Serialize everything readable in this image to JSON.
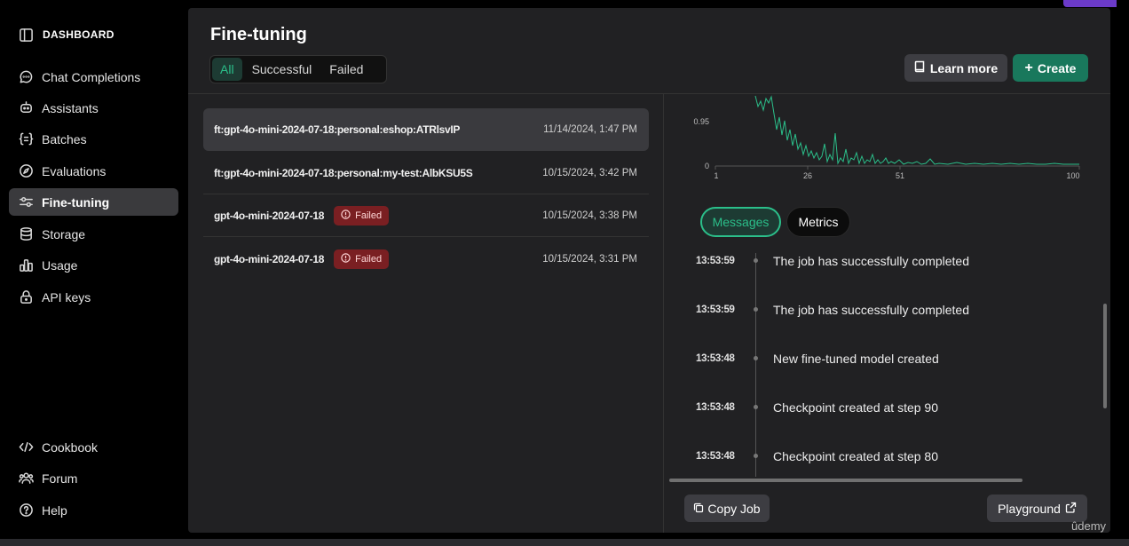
{
  "sidebar": {
    "brand": "DASHBOARD",
    "items": [
      {
        "label": "Chat Completions",
        "icon": "chat-icon"
      },
      {
        "label": "Assistants",
        "icon": "robot-icon"
      },
      {
        "label": "Batches",
        "icon": "braces-icon"
      },
      {
        "label": "Evaluations",
        "icon": "compass-icon"
      },
      {
        "label": "Fine-tuning",
        "icon": "sliders-icon"
      },
      {
        "label": "Storage",
        "icon": "database-icon"
      },
      {
        "label": "Usage",
        "icon": "chart-icon"
      },
      {
        "label": "API keys",
        "icon": "lock-icon"
      }
    ],
    "bottom_items": [
      {
        "label": "Cookbook",
        "icon": "code-icon"
      },
      {
        "label": "Forum",
        "icon": "users-icon"
      },
      {
        "label": "Help",
        "icon": "help-icon"
      }
    ]
  },
  "header": {
    "title": "Fine-tuning",
    "tabs": [
      "All",
      "Successful",
      "Failed"
    ],
    "learn_more": "Learn more",
    "create": "Create"
  },
  "jobs": [
    {
      "name": "ft:gpt-4o-mini-2024-07-18:personal:eshop:ATRlsvIP",
      "date": "11/14/2024, 1:47 PM",
      "status": ""
    },
    {
      "name": "ft:gpt-4o-mini-2024-07-18:personal:my-test:AlbKSU5S",
      "date": "10/15/2024, 3:42 PM",
      "status": ""
    },
    {
      "name": "gpt-4o-mini-2024-07-18",
      "date": "10/15/2024, 3:38 PM",
      "status": "Failed"
    },
    {
      "name": "gpt-4o-mini-2024-07-18",
      "date": "10/15/2024, 3:31 PM",
      "status": "Failed"
    }
  ],
  "chart": {
    "y_ticks": [
      "0.95",
      "0"
    ],
    "x_ticks": [
      "1",
      "26",
      "51",
      "100"
    ],
    "line_color": "#2bbf8a"
  },
  "detail_tabs": {
    "messages": "Messages",
    "metrics": "Metrics"
  },
  "messages": [
    {
      "time": "13:53:59",
      "text": "The job has successfully completed"
    },
    {
      "time": "13:53:59",
      "text": "The job has successfully completed"
    },
    {
      "time": "13:53:48",
      "text": "New fine-tuned model created"
    },
    {
      "time": "13:53:48",
      "text": "Checkpoint created at step 90"
    },
    {
      "time": "13:53:48",
      "text": "Checkpoint created at step 80"
    }
  ],
  "footer": {
    "copy_job": "Copy Job",
    "playground": "Playground"
  },
  "watermark": "ûdemy",
  "colors": {
    "accent": "#2bbf8a",
    "create_button": "#19785c",
    "failed_badge": "#7a1f22"
  }
}
